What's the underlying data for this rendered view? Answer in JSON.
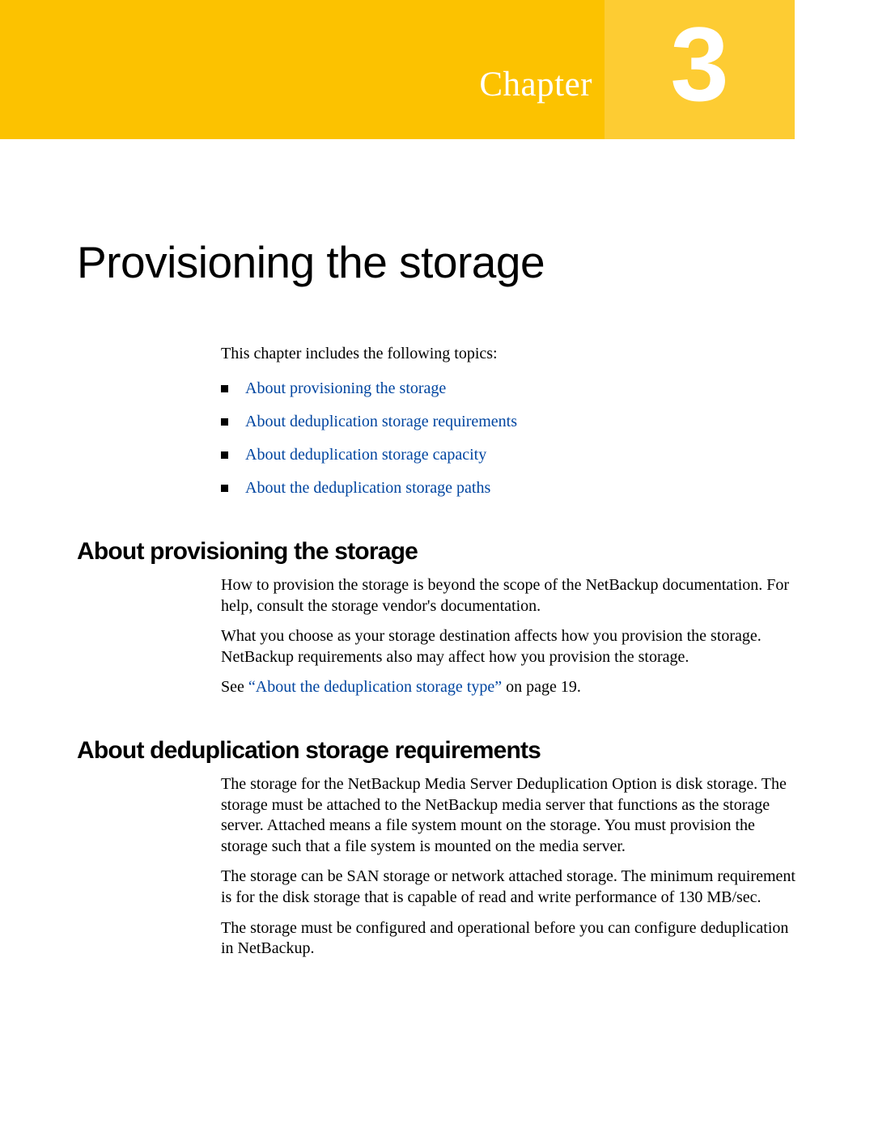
{
  "chapter": {
    "label": "Chapter",
    "number": "3"
  },
  "title": "Provisioning the storage",
  "intro": "This chapter includes the following topics:",
  "topics": [
    "About provisioning the storage",
    "About deduplication storage requirements",
    "About deduplication storage capacity",
    "About the deduplication storage paths"
  ],
  "sections": [
    {
      "heading": "About provisioning the storage",
      "paragraphs": [
        "How to provision the storage is beyond the scope of the NetBackup documentation. For help, consult the storage vendor's documentation.",
        "What you choose as your storage destination affects how you provision the storage. NetBackup requirements also may affect how you provision the storage."
      ],
      "see_prefix": "See ",
      "see_link": "“About the deduplication storage type”",
      "see_suffix": " on page 19."
    },
    {
      "heading": "About deduplication storage requirements",
      "paragraphs": [
        "The storage for the NetBackup Media Server Deduplication Option is disk storage. The storage must be attached to the NetBackup media server that functions as the storage server. Attached means a file system mount on the storage. You must provision the storage such that a file system is mounted on the media server.",
        "The storage can be SAN storage or network attached storage. The minimum requirement is for the disk storage that is capable of read and write performance of 130 MB/sec.",
        "The storage must be configured and operational before you can configure deduplication in NetBackup."
      ]
    }
  ]
}
